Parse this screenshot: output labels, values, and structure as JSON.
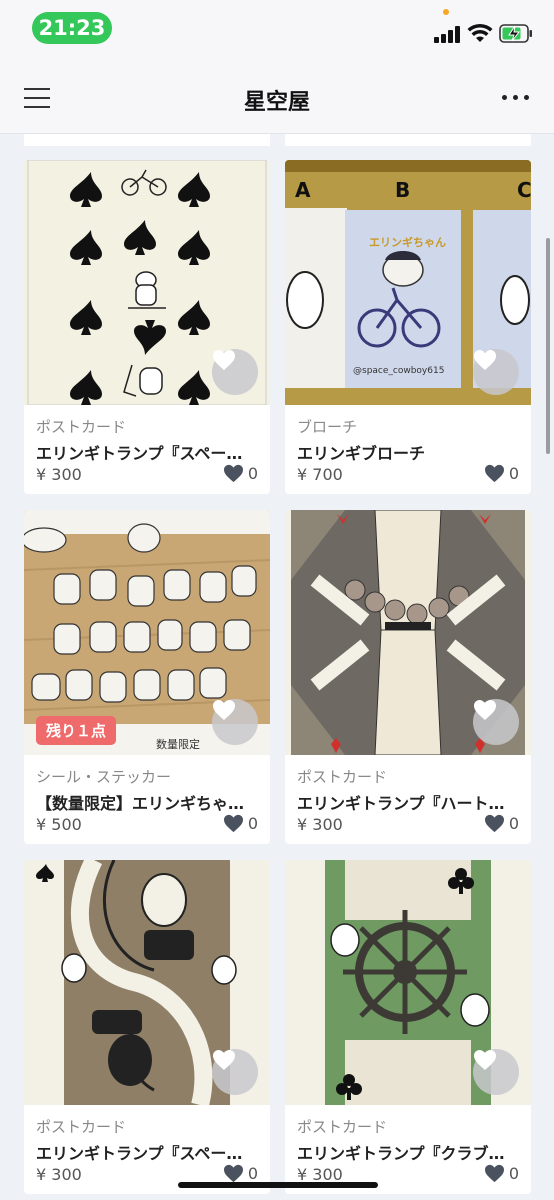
{
  "status_bar": {
    "time": "21:23"
  },
  "nav": {
    "title": "星空屋"
  },
  "products": [
    {
      "category": "ポストカード",
      "title": "エリンギトランプ『スペー…",
      "price": "¥ 300",
      "likes": "0",
      "badge": ""
    },
    {
      "category": "ブローチ",
      "title": "エリンギブローチ",
      "price": "¥ 700",
      "likes": "0",
      "badge": ""
    },
    {
      "category": "シール・ステッカー",
      "title": "【数量限定】エリンギちゃ…",
      "price": "¥ 500",
      "likes": "0",
      "badge": "残り１点"
    },
    {
      "category": "ポストカード",
      "title": "エリンギトランプ『ハート…",
      "price": "¥ 300",
      "likes": "0",
      "badge": ""
    },
    {
      "category": "ポストカード",
      "title": "エリンギトランプ『スペー…",
      "price": "¥ 300",
      "likes": "0",
      "badge": ""
    },
    {
      "category": "ポストカード",
      "title": "エリンギトランプ『クラブ…",
      "price": "¥ 300",
      "likes": "0",
      "badge": ""
    }
  ],
  "image_text": {
    "brooch_letters": [
      "A",
      "B",
      "C"
    ],
    "brooch_card_label": "エリンギちゃん",
    "brooch_handle": "@space_cowboy615",
    "sticker_note": "数量限定"
  },
  "icons": {
    "menu": "hamburger-icon",
    "more": "more-dots-icon",
    "favorite": "heart-icon",
    "likes": "heart-icon"
  },
  "colors": {
    "status_time_pill": "#34c759",
    "badge": "#ef6a6a",
    "like_heart": "#4a5260"
  }
}
